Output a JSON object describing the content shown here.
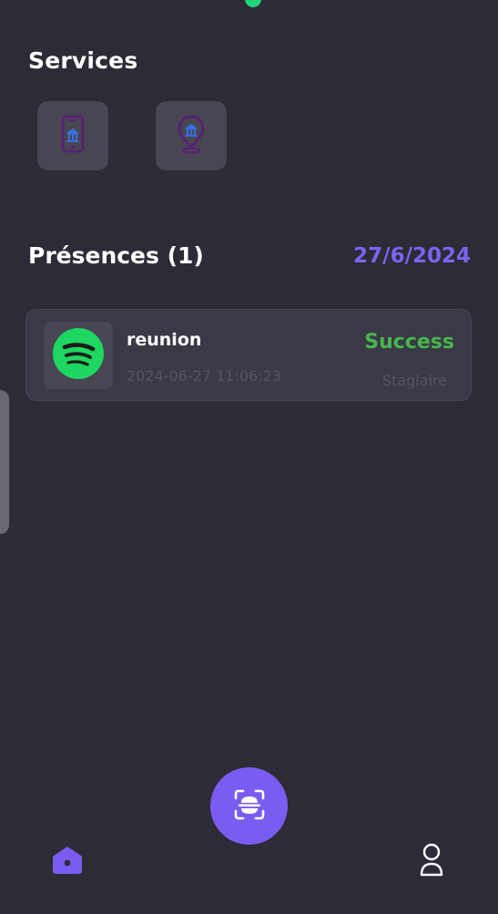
{
  "services": {
    "title": "Services",
    "items": [
      {
        "icon": "mobile-bank-icon"
      },
      {
        "icon": "bank-location-pin-icon"
      }
    ]
  },
  "presences": {
    "title": "Présences (1)",
    "date": "27/6/2024",
    "items": [
      {
        "logo_icon": "spotify-logo-icon",
        "name": "reunion",
        "timestamp": "2024-06-27 11:06:23",
        "status": "Success",
        "role": "Stagiaire"
      }
    ]
  },
  "bottom_nav": {
    "home_icon": "home-icon",
    "scan_icon": "face-scan-icon",
    "profile_icon": "profile-icon"
  },
  "colors": {
    "background": "#2c2b36",
    "accent": "#7b5cf0",
    "success": "#46b54d",
    "status_dot": "#22d47a"
  }
}
